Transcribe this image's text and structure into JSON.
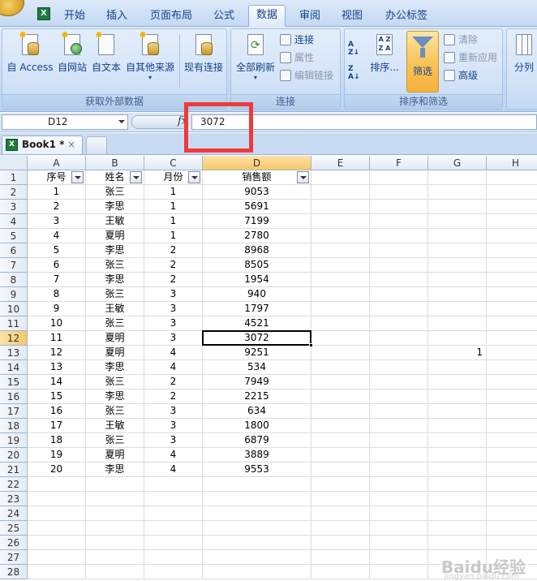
{
  "ribbon_tabs": [
    "开始",
    "插入",
    "页面布局",
    "公式",
    "数据",
    "审阅",
    "视图",
    "办公标签"
  ],
  "active_tab": "数据",
  "ribbon": {
    "external_data": {
      "label": "获取外部数据",
      "from_access": "自 Access",
      "from_web": "自网站",
      "from_text": "自文本",
      "from_other": "自其他来源",
      "existing": "现有连接"
    },
    "connections": {
      "label": "连接",
      "refresh_all": "全部刷新",
      "connections": "连接",
      "properties": "属性",
      "edit_links": "编辑链接"
    },
    "sort_filter": {
      "label": "排序和筛选",
      "sort": "排序...",
      "filter": "筛选",
      "clear": "清除",
      "reapply": "重新应用",
      "advanced": "高级"
    },
    "data_tools": {
      "split": "分列"
    }
  },
  "formula_bar": {
    "name_box": "D12",
    "fx": "fx",
    "value": "3072"
  },
  "workbook_tab": {
    "title": "Book1 *",
    "close": "×"
  },
  "columns": [
    "A",
    "B",
    "C",
    "D",
    "E",
    "F",
    "G",
    "H"
  ],
  "active_column": "D",
  "active_row": 12,
  "header_row": [
    "序号",
    "姓名",
    "月份",
    "销售额"
  ],
  "rows": [
    [
      "1",
      "张三",
      "1",
      "9053"
    ],
    [
      "2",
      "李思",
      "1",
      "5691"
    ],
    [
      "3",
      "王敏",
      "1",
      "7199"
    ],
    [
      "4",
      "夏明",
      "1",
      "2780"
    ],
    [
      "5",
      "李思",
      "2",
      "8968"
    ],
    [
      "6",
      "张三",
      "2",
      "8505"
    ],
    [
      "7",
      "李思",
      "2",
      "1954"
    ],
    [
      "8",
      "张三",
      "3",
      "940"
    ],
    [
      "9",
      "王敏",
      "3",
      "1797"
    ],
    [
      "10",
      "张三",
      "3",
      "4521"
    ],
    [
      "11",
      "夏明",
      "3",
      "3072"
    ],
    [
      "12",
      "夏明",
      "4",
      "9251"
    ],
    [
      "13",
      "李思",
      "4",
      "534"
    ],
    [
      "14",
      "张三",
      "2",
      "7949"
    ],
    [
      "15",
      "李思",
      "2",
      "2215"
    ],
    [
      "16",
      "张三",
      "3",
      "634"
    ],
    [
      "17",
      "王敏",
      "3",
      "1800"
    ],
    [
      "18",
      "张三",
      "3",
      "6879"
    ],
    [
      "19",
      "夏明",
      "4",
      "3889"
    ],
    [
      "20",
      "李思",
      "4",
      "9553"
    ]
  ],
  "g13_value": "1",
  "row_numbers": [
    "1",
    "2",
    "3",
    "4",
    "5",
    "6",
    "7",
    "8",
    "9",
    "10",
    "11",
    "12",
    "13",
    "14",
    "15",
    "16",
    "17",
    "18",
    "19",
    "20",
    "21",
    "22",
    "23",
    "24",
    "25",
    "26",
    "27",
    "28"
  ],
  "watermark": "Baidu经验",
  "watermark_sub": "jingyan.baidu.com",
  "colors": {
    "highlight": "#ee3a3a",
    "active_header": "#f7c766",
    "ribbon_text": "#15428b"
  }
}
